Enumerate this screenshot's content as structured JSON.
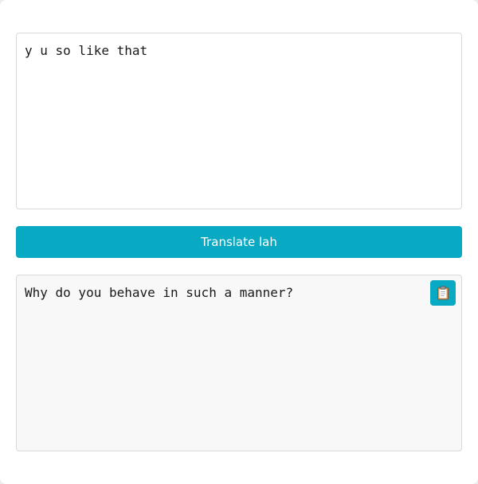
{
  "input": {
    "value": "y u so like that"
  },
  "translate_button": {
    "label": "Translate lah"
  },
  "output": {
    "text": "Why do you behave in such a manner?",
    "copy_icon": "clipboard-icon"
  },
  "colors": {
    "accent": "#08a9c2",
    "page_background": "#ececec",
    "output_background": "#f8f8f8"
  }
}
